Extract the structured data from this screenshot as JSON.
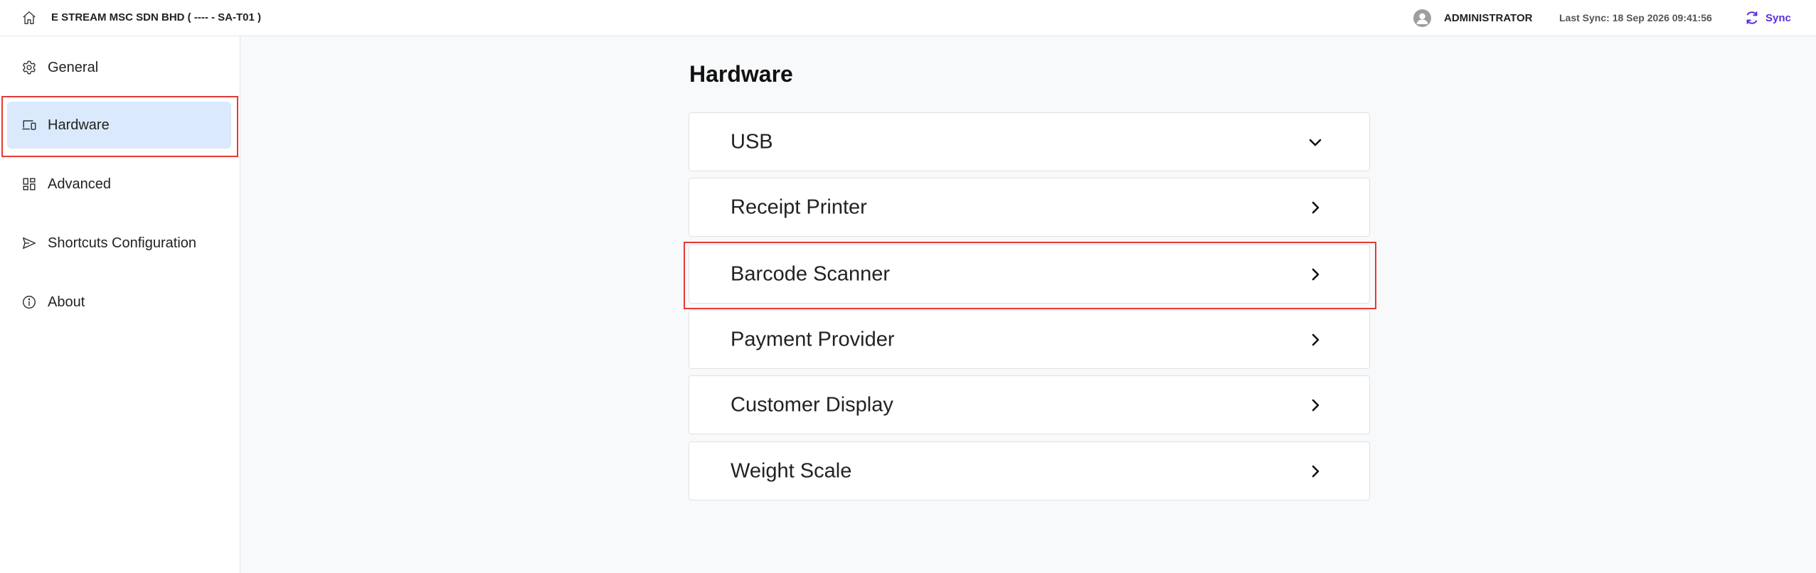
{
  "topbar": {
    "company": "E STREAM MSC SDN BHD ( ---- - SA-T01 )",
    "user": "ADMINISTRATOR",
    "last_sync": "Last Sync: 18 Sep 2026 09:41:56",
    "sync_label": "Sync",
    "sync_color": "#5b2be0"
  },
  "sidebar": {
    "items": [
      {
        "label": "General",
        "icon": "gear-icon"
      },
      {
        "label": "Hardware",
        "icon": "devices-icon",
        "active": true
      },
      {
        "label": "Advanced",
        "icon": "dashboard-grid-icon"
      },
      {
        "label": "Shortcuts Configuration",
        "icon": "send-icon"
      },
      {
        "label": "About",
        "icon": "info-icon"
      }
    ],
    "active_bg": "#dbe9fd"
  },
  "main": {
    "title": "Hardware",
    "sections": [
      {
        "label": "USB",
        "icon": "chevron-down-icon",
        "expanded": true
      },
      {
        "label": "Receipt Printer",
        "icon": "chevron-right-icon"
      },
      {
        "label": "Barcode Scanner",
        "icon": "chevron-right-icon",
        "highlighted": true
      },
      {
        "label": "Payment Provider",
        "icon": "chevron-right-icon"
      },
      {
        "label": "Customer Display",
        "icon": "chevron-right-icon"
      },
      {
        "label": "Weight Scale",
        "icon": "chevron-right-icon"
      }
    ]
  },
  "highlight_color": "#e53935"
}
